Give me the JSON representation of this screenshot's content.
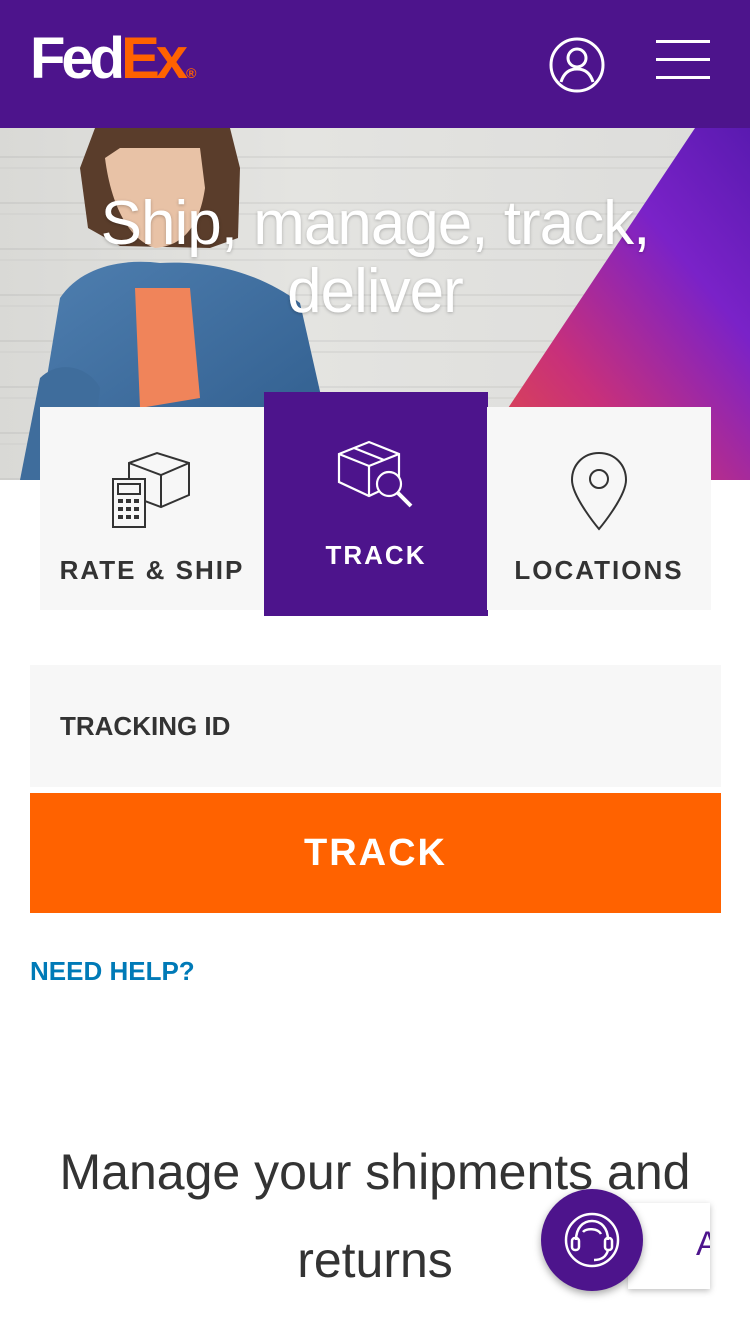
{
  "header": {
    "logo": {
      "part1": "Fed",
      "part2": "Ex",
      "mark": "®"
    },
    "profile_icon": "user-circle-icon",
    "menu_icon": "hamburger-menu-icon"
  },
  "hero": {
    "title": "Ship, manage, track, deliver"
  },
  "tabs": [
    {
      "label": "RATE & SHIP",
      "icon": "calculator-box-icon",
      "active": false
    },
    {
      "label": "TRACK",
      "icon": "box-magnifier-icon",
      "active": true
    },
    {
      "label": "LOCATIONS",
      "icon": "map-pin-icon",
      "active": false
    }
  ],
  "tracking": {
    "placeholder": "TRACKING ID",
    "value": "",
    "button_label": "TRACK",
    "help_link": "NEED HELP?"
  },
  "section": {
    "heading": "Manage your shipments and returns"
  },
  "chat": {
    "icon": "headset-agent-icon",
    "tab_text": "A"
  },
  "colors": {
    "brand_purple": "#4d148c",
    "brand_orange": "#ff6200",
    "link_blue": "#007ab7",
    "tab_bg": "#f7f7f7",
    "text_dark": "#333333"
  }
}
